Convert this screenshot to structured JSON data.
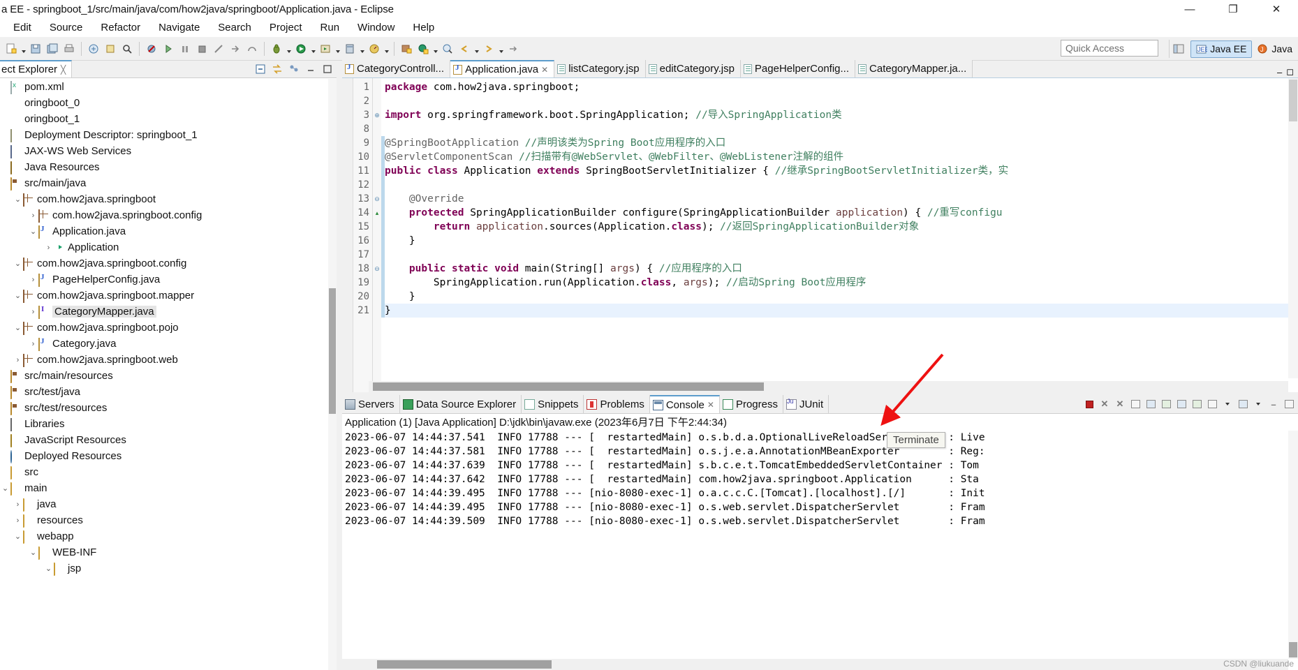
{
  "window": {
    "title": "a EE - springboot_1/src/main/java/com/how2java/springboot/Application.java - Eclipse",
    "minimize": "—",
    "maximize": "❐",
    "close": "✕"
  },
  "menu": {
    "items": [
      "Edit",
      "Source",
      "Refactor",
      "Navigate",
      "Search",
      "Project",
      "Run",
      "Window",
      "Help"
    ]
  },
  "toolbar": {
    "quick_access_placeholder": "Quick Access",
    "perspectives": [
      {
        "label": "Java EE",
        "active": true
      },
      {
        "label": "Java",
        "active": false
      }
    ]
  },
  "explorer": {
    "tab_label": "ect Explorer",
    "tree": [
      {
        "label": "pom.xml",
        "indent": 1,
        "twisty": "",
        "icon": "ico-xml"
      },
      {
        "label": "oringboot_0",
        "indent": 0,
        "twisty": "",
        "icon": ""
      },
      {
        "label": "oringboot_1",
        "indent": 0,
        "twisty": "",
        "icon": ""
      },
      {
        "label": "Deployment Descriptor: springboot_1",
        "indent": 0,
        "twisty": "",
        "icon": "ico-dd"
      },
      {
        "label": "JAX-WS Web Services",
        "indent": 0,
        "twisty": "",
        "icon": "ico-ws"
      },
      {
        "label": "Java Resources",
        "indent": 0,
        "twisty": "",
        "icon": "ico-jr"
      },
      {
        "label": "src/main/java",
        "indent": 1,
        "twisty": "",
        "icon": "ico-srcfolder"
      },
      {
        "label": "com.how2java.springboot",
        "indent": 2,
        "twisty": "⌄",
        "icon": "ico-pkg"
      },
      {
        "label": "com.how2java.springboot.config",
        "indent": 3,
        "twisty": "›",
        "icon": "ico-pkg"
      },
      {
        "label": "Application.java",
        "indent": 3,
        "twisty": "⌄",
        "icon": "ico-java"
      },
      {
        "label": "Application",
        "indent": 4,
        "twisty": "›",
        "icon": "ico-class"
      },
      {
        "label": "com.how2java.springboot.config",
        "indent": 2,
        "twisty": "⌄",
        "icon": "ico-pkg"
      },
      {
        "label": "PageHelperConfig.java",
        "indent": 3,
        "twisty": "›",
        "icon": "ico-java"
      },
      {
        "label": "com.how2java.springboot.mapper",
        "indent": 2,
        "twisty": "⌄",
        "icon": "ico-pkg"
      },
      {
        "label": "CategoryMapper.java",
        "indent": 3,
        "twisty": "›",
        "icon": "ico-javaif",
        "selected": true
      },
      {
        "label": "com.how2java.springboot.pojo",
        "indent": 2,
        "twisty": "⌄",
        "icon": "ico-pkg"
      },
      {
        "label": "Category.java",
        "indent": 3,
        "twisty": "›",
        "icon": "ico-java"
      },
      {
        "label": "com.how2java.springboot.web",
        "indent": 2,
        "twisty": "›",
        "icon": "ico-pkg"
      },
      {
        "label": "src/main/resources",
        "indent": 1,
        "twisty": "",
        "icon": "ico-srcfolder"
      },
      {
        "label": "src/test/java",
        "indent": 1,
        "twisty": "",
        "icon": "ico-srcfolder"
      },
      {
        "label": "src/test/resources",
        "indent": 1,
        "twisty": "",
        "icon": "ico-srcfolder"
      },
      {
        "label": "Libraries",
        "indent": 1,
        "twisty": "",
        "icon": "ico-lib"
      },
      {
        "label": "JavaScript Resources",
        "indent": 0,
        "twisty": "",
        "icon": "ico-js"
      },
      {
        "label": "Deployed Resources",
        "indent": 0,
        "twisty": "",
        "icon": "ico-dep"
      },
      {
        "label": "src",
        "indent": 0,
        "twisty": "",
        "icon": "ico-folder"
      },
      {
        "label": "main",
        "indent": 1,
        "twisty": "⌄",
        "icon": "ico-folder"
      },
      {
        "label": "java",
        "indent": 2,
        "twisty": "›",
        "icon": "ico-folder"
      },
      {
        "label": "resources",
        "indent": 2,
        "twisty": "›",
        "icon": "ico-folder"
      },
      {
        "label": "webapp",
        "indent": 2,
        "twisty": "⌄",
        "icon": "ico-folder"
      },
      {
        "label": "WEB-INF",
        "indent": 3,
        "twisty": "⌄",
        "icon": "ico-folder"
      },
      {
        "label": "jsp",
        "indent": 4,
        "twisty": "⌄",
        "icon": "ico-folder"
      }
    ]
  },
  "editor": {
    "tabs": [
      {
        "label": "CategoryControll...",
        "icon": "java",
        "active": false,
        "closable": false
      },
      {
        "label": "Application.java",
        "icon": "java",
        "active": true,
        "closable": true
      },
      {
        "label": "listCategory.jsp",
        "icon": "jsp",
        "active": false,
        "closable": false
      },
      {
        "label": "editCategory.jsp",
        "icon": "jsp",
        "active": false,
        "closable": false
      },
      {
        "label": "PageHelperConfig...",
        "icon": "jsp",
        "active": false,
        "closable": false
      },
      {
        "label": "CategoryMapper.ja...",
        "icon": "jsp",
        "active": false,
        "closable": false
      }
    ],
    "line_numbers": [
      "1",
      "2",
      "3",
      "8",
      "9",
      "10",
      "11",
      "12",
      "13",
      "14",
      "15",
      "16",
      "17",
      "18",
      "19",
      "20",
      "21"
    ],
    "folding_markers": [
      "",
      "",
      "⊕",
      "",
      "",
      "",
      "",
      "",
      "⊖",
      "▴",
      "",
      "",
      "",
      "⊖",
      "",
      "",
      ""
    ],
    "code": [
      {
        "n": 1,
        "segments": [
          {
            "t": "package ",
            "c": "kw"
          },
          {
            "t": "com.how2java.springboot;",
            "c": "pl"
          }
        ]
      },
      {
        "n": 2,
        "segments": []
      },
      {
        "n": 3,
        "segments": [
          {
            "t": "import ",
            "c": "kw"
          },
          {
            "t": "org.springframework.boot.SpringApplication; ",
            "c": "pl"
          },
          {
            "t": "//导入SpringApplication类",
            "c": "cm"
          }
        ]
      },
      {
        "n": 8,
        "segments": []
      },
      {
        "n": 9,
        "segments": [
          {
            "t": "@SpringBootApplication ",
            "c": "an"
          },
          {
            "t": "//声明该类为Spring Boot应用程序的入口",
            "c": "cm"
          }
        ]
      },
      {
        "n": 10,
        "segments": [
          {
            "t": "@ServletComponentScan ",
            "c": "an"
          },
          {
            "t": "//扫描带有@WebServlet、@WebFilter、@WebListener注解的组件",
            "c": "cm"
          }
        ]
      },
      {
        "n": 11,
        "segments": [
          {
            "t": "public class ",
            "c": "kw"
          },
          {
            "t": "Application ",
            "c": "pl"
          },
          {
            "t": "extends ",
            "c": "kw"
          },
          {
            "t": "SpringBootServletInitializer { ",
            "c": "pl"
          },
          {
            "t": "//继承SpringBootServletInitializer类，实",
            "c": "cm"
          }
        ]
      },
      {
        "n": 12,
        "segments": []
      },
      {
        "n": 13,
        "segments": [
          {
            "t": "    @Override",
            "c": "an"
          }
        ]
      },
      {
        "n": 14,
        "segments": [
          {
            "t": "    protected ",
            "c": "kw"
          },
          {
            "t": "SpringApplicationBuilder configure(SpringApplicationBuilder ",
            "c": "pl"
          },
          {
            "t": "application",
            "c": "loc"
          },
          {
            "t": ") { ",
            "c": "pl"
          },
          {
            "t": "//重写configu",
            "c": "cm"
          }
        ]
      },
      {
        "n": 15,
        "segments": [
          {
            "t": "        return ",
            "c": "kw"
          },
          {
            "t": "application",
            "c": "loc"
          },
          {
            "t": ".sources(Application.",
            "c": "pl"
          },
          {
            "t": "class",
            "c": "kw"
          },
          {
            "t": "); ",
            "c": "pl"
          },
          {
            "t": "//返回SpringApplicationBuilder对象",
            "c": "cm"
          }
        ]
      },
      {
        "n": 16,
        "segments": [
          {
            "t": "    }",
            "c": "pl"
          }
        ]
      },
      {
        "n": 17,
        "segments": []
      },
      {
        "n": 18,
        "segments": [
          {
            "t": "    public static void ",
            "c": "kw"
          },
          {
            "t": "main(String[] ",
            "c": "pl"
          },
          {
            "t": "args",
            "c": "loc"
          },
          {
            "t": ") { ",
            "c": "pl"
          },
          {
            "t": "//应用程序的入口",
            "c": "cm"
          }
        ]
      },
      {
        "n": 19,
        "segments": [
          {
            "t": "        SpringApplication.",
            "c": "pl"
          },
          {
            "t": "run",
            "c": "pl"
          },
          {
            "t": "(Application.",
            "c": "pl"
          },
          {
            "t": "class",
            "c": "kw"
          },
          {
            "t": ", ",
            "c": "pl"
          },
          {
            "t": "args",
            "c": "loc"
          },
          {
            "t": "); ",
            "c": "pl"
          },
          {
            "t": "//启动Spring Boot应用程序",
            "c": "cm"
          }
        ]
      },
      {
        "n": 20,
        "segments": [
          {
            "t": "    }",
            "c": "pl"
          }
        ]
      },
      {
        "n": 21,
        "segments": [
          {
            "t": "}",
            "c": "pl"
          }
        ],
        "highlight": true
      }
    ]
  },
  "console": {
    "tabs": [
      {
        "label": "Servers",
        "icon": "ico-servers",
        "active": false
      },
      {
        "label": "Data Source Explorer",
        "icon": "ico-dse",
        "active": false
      },
      {
        "label": "Snippets",
        "icon": "ico-snip",
        "active": false
      },
      {
        "label": "Problems",
        "icon": "ico-prob",
        "active": false
      },
      {
        "label": "Console",
        "icon": "ico-cons",
        "active": true,
        "closable": true
      },
      {
        "label": "Progress",
        "icon": "ico-prog",
        "active": false
      },
      {
        "label": "JUnit",
        "icon": "ico-junit",
        "active": false
      }
    ],
    "launch_title": "Application (1) [Java Application] D:\\jdk\\bin\\javaw.exe (2023年6月7日 下午2:44:34)",
    "tooltip": "Terminate",
    "log_lines": [
      "2023-06-07 14:44:37.541  INFO 17788 --- [  restartedMain] o.s.b.d.a.OptionalLiveReloadServer       : Live",
      "2023-06-07 14:44:37.581  INFO 17788 --- [  restartedMain] o.s.j.e.a.AnnotationMBeanExporter        : Reg:",
      "2023-06-07 14:44:37.639  INFO 17788 --- [  restartedMain] s.b.c.e.t.TomcatEmbeddedServletContainer : Tom",
      "2023-06-07 14:44:37.642  INFO 17788 --- [  restartedMain] com.how2java.springboot.Application      : Sta",
      "2023-06-07 14:44:39.495  INFO 17788 --- [nio-8080-exec-1] o.a.c.c.C.[Tomcat].[localhost].[/]       : Init",
      "2023-06-07 14:44:39.495  INFO 17788 --- [nio-8080-exec-1] o.s.web.servlet.DispatcherServlet        : Fram",
      "2023-06-07 14:44:39.509  INFO 17788 --- [nio-8080-exec-1] o.s.web.servlet.DispatcherServlet        : Fram"
    ]
  },
  "watermark": "CSDN @liukuande"
}
